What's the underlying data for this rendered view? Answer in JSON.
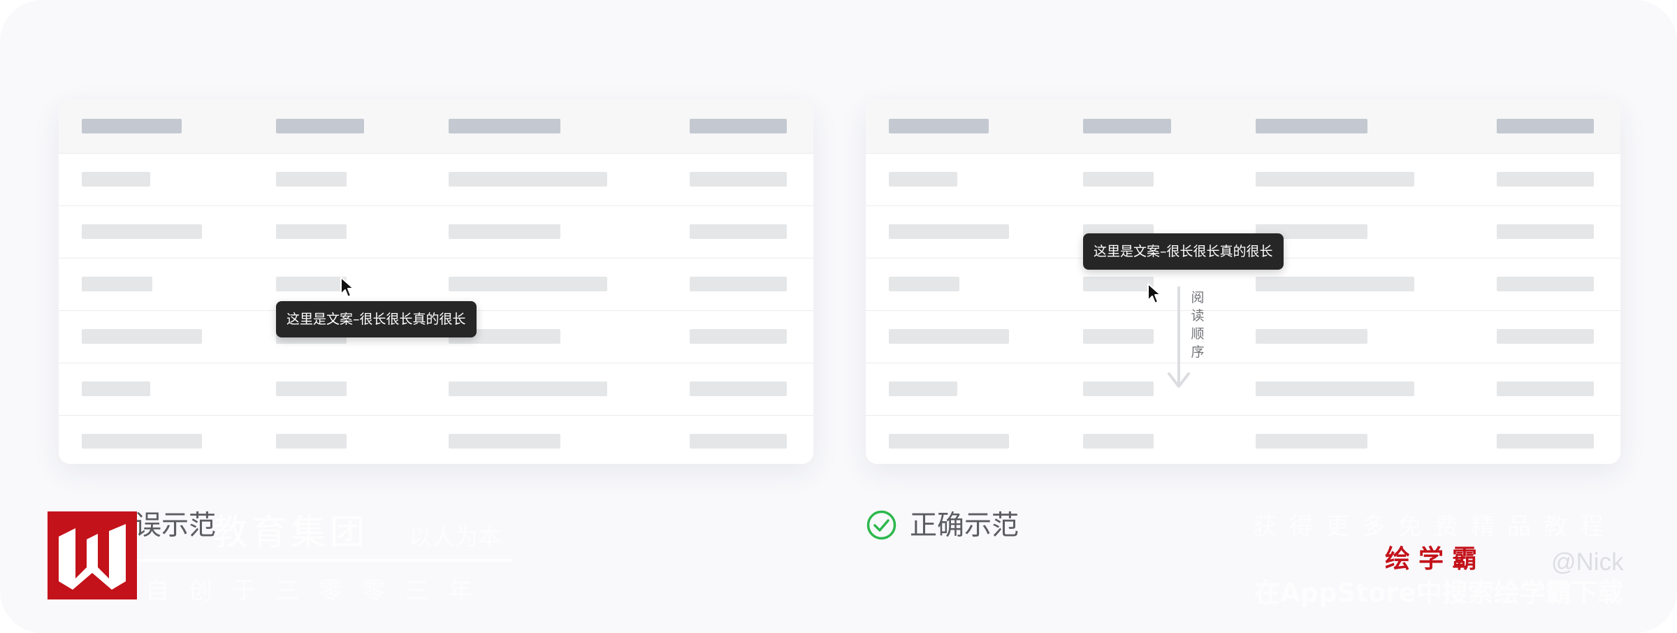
{
  "examples": {
    "wrong": {
      "label": "误示范",
      "tooltip": "这里是文案–很长很长真的很长"
    },
    "correct": {
      "label": "正确示范",
      "tooltip": "这里是文案–很长很长真的很长",
      "reading_order_label": "阅读顺序",
      "icon": "check-circle-icon",
      "icon_color": "#2db84d"
    }
  },
  "table": {
    "header_cells": 4,
    "body_rows": 6
  },
  "watermarks": {
    "group_text": "教育集团",
    "people_text": "以人为本",
    "since_text": "自创于三零零三年",
    "more_text": "获得更多免费精品教程",
    "app_text": "在AppStore中搜索绘学霸下载",
    "brand": "绘学霸",
    "brand_color": "#c3121a",
    "author": "@Nick"
  },
  "colors": {
    "header_placeholder": "#c4c9d1",
    "body_placeholder": "#e5e6e8",
    "tooltip_background": "#262626"
  }
}
